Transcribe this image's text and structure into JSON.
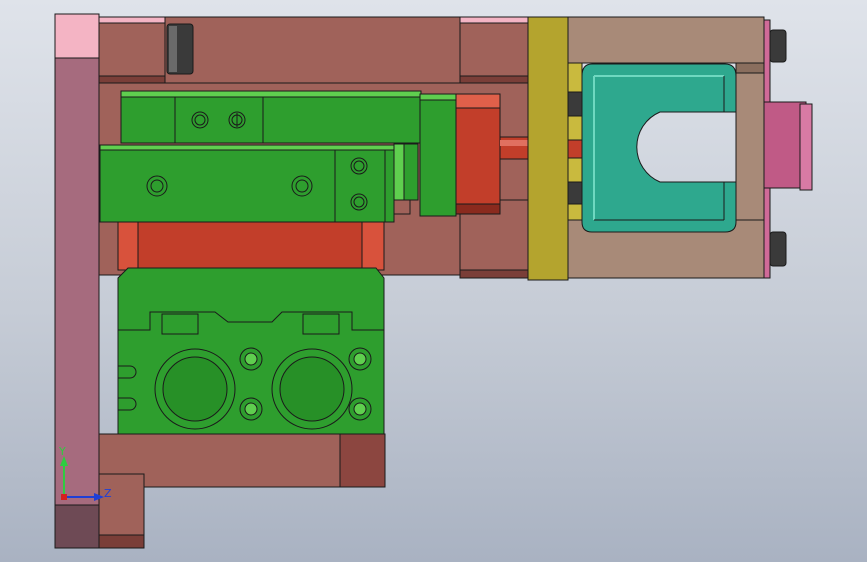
{
  "viewport": {
    "background_top": "#dfe3ea",
    "background_bottom": "#a9b2c2"
  },
  "colors": {
    "plate_brown": "#a0625a",
    "plate_tan": "#a88a78",
    "plate_pink": "#a66b7e",
    "highlight_pink": "#f4b4c4",
    "part_red": "#c23e2a",
    "part_green": "#2e9e2e",
    "part_green_light": "#5fcf4f",
    "part_teal": "#2ea88e",
    "part_olive": "#b4a42e",
    "part_magenta": "#c05a86",
    "part_dark": "#3a3a3a"
  },
  "triad": {
    "y_label": "Y",
    "z_label": "Z",
    "y_color": "#2ecc40",
    "z_color": "#1f3fd6",
    "origin_color": "#d42020"
  }
}
